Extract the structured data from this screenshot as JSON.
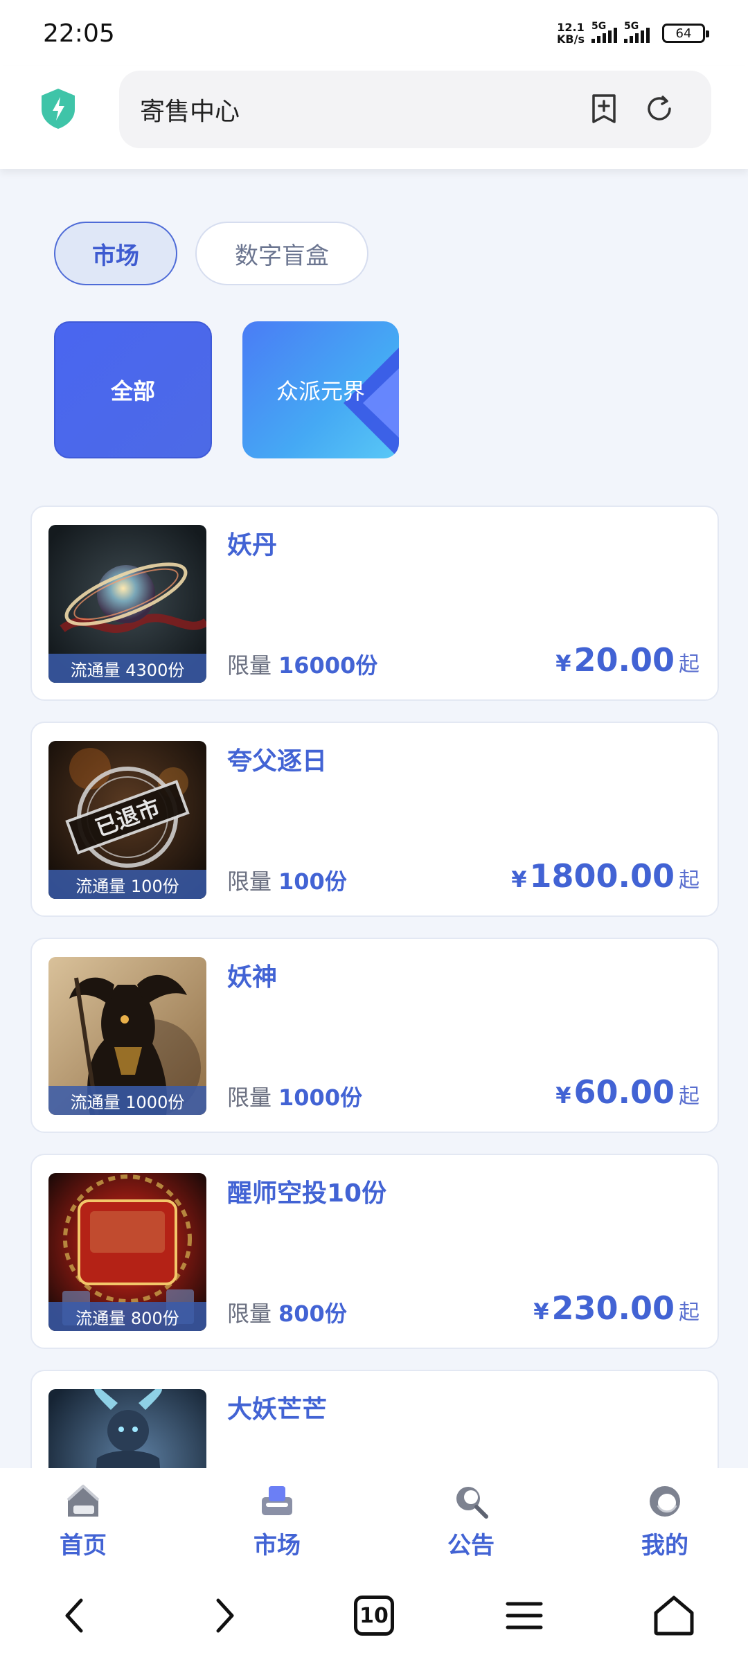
{
  "status_bar": {
    "time": "22:05",
    "net_speed_value": "12.1",
    "net_speed_unit": "KB/s",
    "signal_label_1": "5G",
    "signal_label_2": "5G",
    "battery": "64"
  },
  "top_bar": {
    "title": "寄售中心"
  },
  "tabs": [
    {
      "label": "市场",
      "active": true
    },
    {
      "label": "数字盲盒",
      "active": false
    }
  ],
  "categories": [
    {
      "label": "全部"
    },
    {
      "label": "众派元界"
    }
  ],
  "products": [
    {
      "name": "妖丹",
      "circulation": "流通量 4300份",
      "limit_label": "限量",
      "limit_value": "16000份",
      "currency": "¥",
      "price": "20.00",
      "price_suffix": "起"
    },
    {
      "name": "夸父逐日",
      "circulation": "流通量 100份",
      "limit_label": "限量",
      "limit_value": "100份",
      "currency": "¥",
      "price": "1800.00",
      "price_suffix": "起",
      "stamp_text": "已退市"
    },
    {
      "name": "妖神",
      "circulation": "流通量 1000份",
      "limit_label": "限量",
      "limit_value": "1000份",
      "currency": "¥",
      "price": "60.00",
      "price_suffix": "起"
    },
    {
      "name": "醒师空投10份",
      "circulation": "流通量 800份",
      "limit_label": "限量",
      "limit_value": "800份",
      "currency": "¥",
      "price": "230.00",
      "price_suffix": "起"
    },
    {
      "name": "大妖芒芒"
    }
  ],
  "bottom_nav": [
    {
      "label": "首页",
      "icon": "home-icon"
    },
    {
      "label": "市场",
      "icon": "market-icon"
    },
    {
      "label": "公告",
      "icon": "announcement-icon"
    },
    {
      "label": "我的",
      "icon": "profile-icon"
    }
  ],
  "system_nav": {
    "tab_count": "10"
  },
  "colors": {
    "accent": "#4263d4",
    "background": "#f2f5fb"
  }
}
